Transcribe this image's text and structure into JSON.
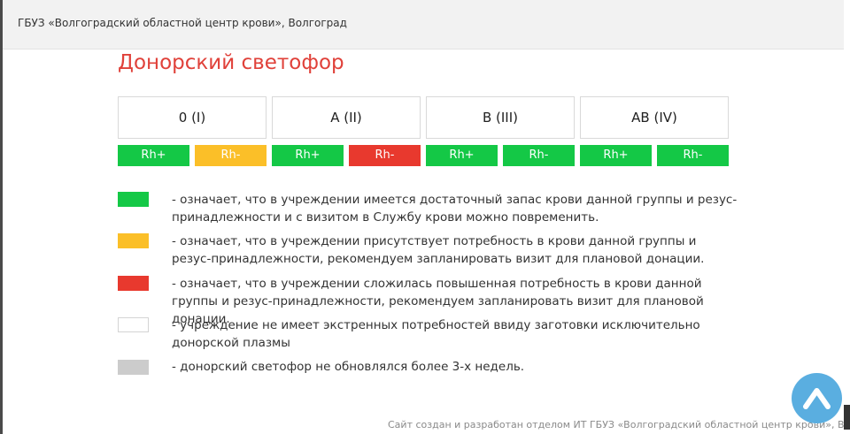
{
  "header": {
    "org_title": "ГБУЗ «Волгоградский областной центр крови», Волгоград"
  },
  "main": {
    "title": "Донорский светофор",
    "groups": [
      {
        "label": "0 (I)",
        "rh_plus": {
          "label": "Rh+",
          "status": "sufficient",
          "color": "#14c846"
        },
        "rh_minus": {
          "label": "Rh-",
          "status": "need",
          "color": "#fbbf28"
        }
      },
      {
        "label": "A (II)",
        "rh_plus": {
          "label": "Rh+",
          "status": "sufficient",
          "color": "#14c846"
        },
        "rh_minus": {
          "label": "Rh-",
          "status": "high-need",
          "color": "#e8392e"
        }
      },
      {
        "label": "B (III)",
        "rh_plus": {
          "label": "Rh+",
          "status": "sufficient",
          "color": "#14c846"
        },
        "rh_minus": {
          "label": "Rh-",
          "status": "sufficient",
          "color": "#14c846"
        }
      },
      {
        "label": "AB (IV)",
        "rh_plus": {
          "label": "Rh+",
          "status": "sufficient",
          "color": "#14c846"
        },
        "rh_minus": {
          "label": "Rh-",
          "status": "sufficient",
          "color": "#14c846"
        }
      }
    ]
  },
  "legend": [
    {
      "color": "#14c846",
      "text": "- означает, что в учреждении имеется достаточный запас крови данной группы и резус-принадлежности и с визитом в Службу крови можно повременить."
    },
    {
      "color": "#fbbf28",
      "text": "- означает, что в учреждении присутствует потребность в крови данной группы и резус-принадлежности, рекомендуем запланировать визит для плановой донации."
    },
    {
      "color": "#e8392e",
      "text": "- означает, что в учреждении сложилась повышенная потребность в крови данной группы и резус-принадлежности, рекомендуем запланировать визит для плановой донации."
    },
    {
      "color": "#ffffff",
      "text": "- учреждение не имеет экстренных потребностей ввиду заготовки исключительно донорской плазмы"
    },
    {
      "color": "#cccccc",
      "text": "- донорский светофор не обновлялся более 3-х недель."
    }
  ],
  "footer": {
    "text": "Сайт создан и разработан отделом ИТ ГБУЗ «Волгоградский областной центр крови», Волгоград"
  },
  "scroll_top": {
    "icon": "chevron-up-icon",
    "color": "#5aaee0"
  }
}
